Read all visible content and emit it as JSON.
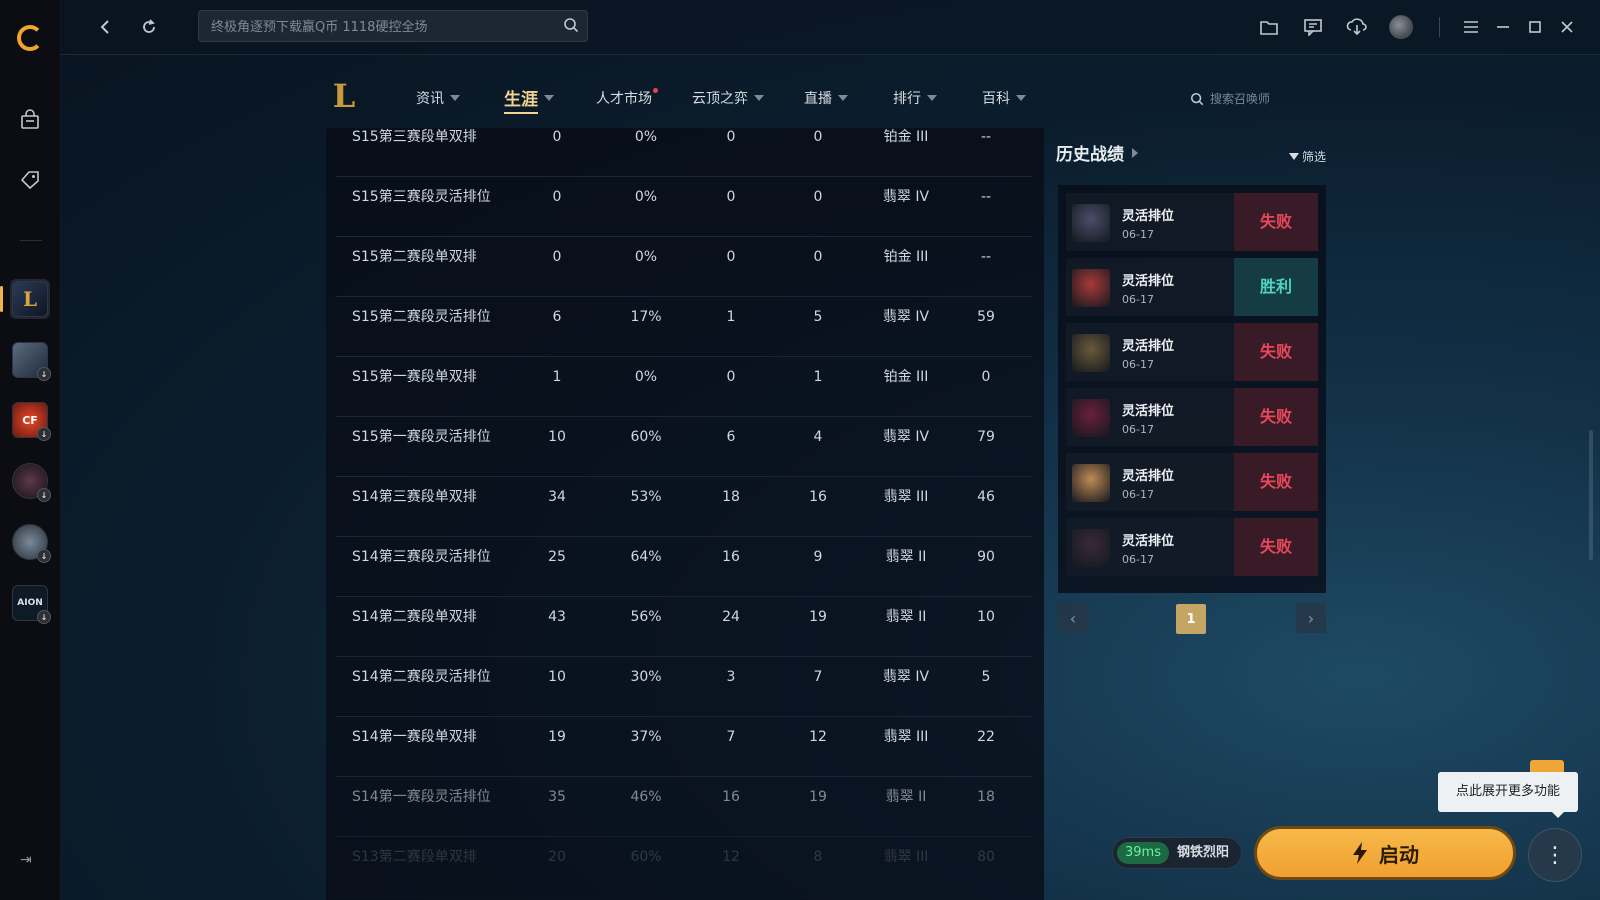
{
  "topbar": {
    "search_placeholder": "终极角逐预下载赢Q币 1118硬控全场"
  },
  "nav": {
    "tabs": [
      {
        "label": "资讯"
      },
      {
        "label": "生涯"
      },
      {
        "label": "人才市场"
      },
      {
        "label": "云顶之弈"
      },
      {
        "label": "直播"
      },
      {
        "label": "排行"
      },
      {
        "label": "百科"
      }
    ],
    "active_tab": "生涯",
    "summoner_search_placeholder": "搜索召唤师"
  },
  "career_table": {
    "rows": [
      {
        "season": "S15第三赛段单双排",
        "games": "0",
        "winrate": "0%",
        "wins": "0",
        "losses": "0",
        "rank": "铂金 III",
        "points": "--"
      },
      {
        "season": "S15第三赛段灵活排位",
        "games": "0",
        "winrate": "0%",
        "wins": "0",
        "losses": "0",
        "rank": "翡翠 IV",
        "points": "--"
      },
      {
        "season": "S15第二赛段单双排",
        "games": "0",
        "winrate": "0%",
        "wins": "0",
        "losses": "0",
        "rank": "铂金 III",
        "points": "--"
      },
      {
        "season": "S15第二赛段灵活排位",
        "games": "6",
        "winrate": "17%",
        "wins": "1",
        "losses": "5",
        "rank": "翡翠 IV",
        "points": "59"
      },
      {
        "season": "S15第一赛段单双排",
        "games": "1",
        "winrate": "0%",
        "wins": "0",
        "losses": "1",
        "rank": "铂金 III",
        "points": "0"
      },
      {
        "season": "S15第一赛段灵活排位",
        "games": "10",
        "winrate": "60%",
        "wins": "6",
        "losses": "4",
        "rank": "翡翠 IV",
        "points": "79"
      },
      {
        "season": "S14第三赛段单双排",
        "games": "34",
        "winrate": "53%",
        "wins": "18",
        "losses": "16",
        "rank": "翡翠 III",
        "points": "46"
      },
      {
        "season": "S14第三赛段灵活排位",
        "games": "25",
        "winrate": "64%",
        "wins": "16",
        "losses": "9",
        "rank": "翡翠 II",
        "points": "90"
      },
      {
        "season": "S14第二赛段单双排",
        "games": "43",
        "winrate": "56%",
        "wins": "24",
        "losses": "19",
        "rank": "翡翠 II",
        "points": "10"
      },
      {
        "season": "S14第二赛段灵活排位",
        "games": "10",
        "winrate": "30%",
        "wins": "3",
        "losses": "7",
        "rank": "翡翠 IV",
        "points": "5"
      },
      {
        "season": "S14第一赛段单双排",
        "games": "19",
        "winrate": "37%",
        "wins": "7",
        "losses": "12",
        "rank": "翡翠 III",
        "points": "22"
      },
      {
        "season": "S14第一赛段灵活排位",
        "games": "35",
        "winrate": "46%",
        "wins": "16",
        "losses": "19",
        "rank": "翡翠 II",
        "points": "18"
      },
      {
        "season": "S13第二赛段单双排",
        "games": "20",
        "winrate": "60%",
        "wins": "12",
        "losses": "8",
        "rank": "翡翠 III",
        "points": "80"
      }
    ]
  },
  "history": {
    "title": "历史战绩",
    "filter_label": "筛选",
    "matches": [
      {
        "mode": "灵活排位",
        "date": "06-17",
        "result": "失败",
        "outcome": "lose",
        "color": "#4a4e6a"
      },
      {
        "mode": "灵活排位",
        "date": "06-17",
        "result": "胜利",
        "outcome": "win",
        "color": "#a83a3a"
      },
      {
        "mode": "灵活排位",
        "date": "06-17",
        "result": "失败",
        "outcome": "lose",
        "color": "#6a5a3a"
      },
      {
        "mode": "灵活排位",
        "date": "06-17",
        "result": "失败",
        "outcome": "lose",
        "color": "#6a2038"
      },
      {
        "mode": "灵活排位",
        "date": "06-17",
        "result": "失败",
        "outcome": "lose",
        "color": "#c08a56"
      },
      {
        "mode": "灵活排位",
        "date": "06-17",
        "result": "失败",
        "outcome": "lose",
        "color": "#3a2a3a"
      }
    ],
    "page": "1"
  },
  "status": {
    "ping": "39ms",
    "server": "钢铁烈阳"
  },
  "launch_label": "启动",
  "tooltip": "点此展开更多功能",
  "sidebar": {
    "games": [
      {
        "name": "lol",
        "label": "L"
      },
      {
        "name": "game-2",
        "label": ""
      },
      {
        "name": "game-cf",
        "label": "CF"
      },
      {
        "name": "game-4",
        "label": ""
      },
      {
        "name": "game-5",
        "label": ""
      },
      {
        "name": "game-aion",
        "label": "AION"
      }
    ]
  }
}
